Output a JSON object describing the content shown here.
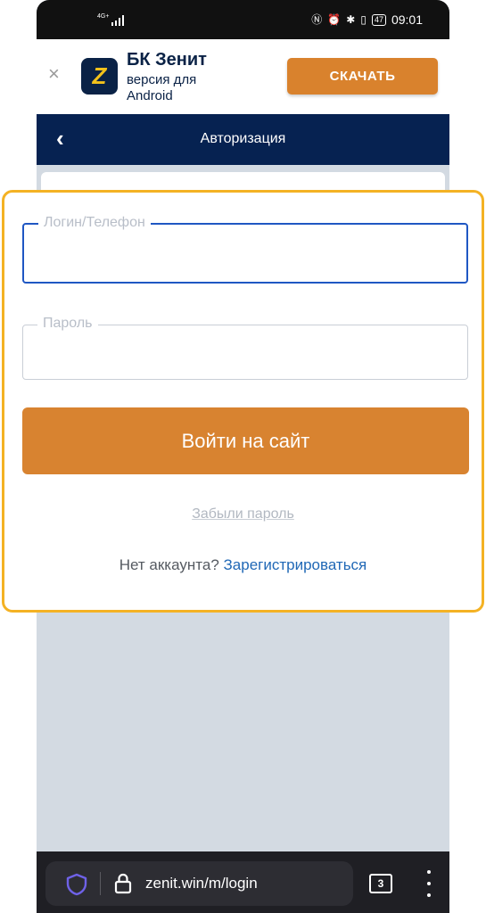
{
  "status_bar": {
    "network": "4G+",
    "battery": "47",
    "time": "09:01",
    "icons": [
      "nfc-icon",
      "alarm-icon",
      "bluetooth-icon",
      "vibrate-icon",
      "battery-icon"
    ]
  },
  "banner": {
    "close": "×",
    "logo_letter": "Z",
    "title": "БК Зенит",
    "subtitle": "версия для Android",
    "download_label": "СКАЧАТЬ"
  },
  "header": {
    "back": "‹",
    "title": "Авторизация"
  },
  "form": {
    "login_label": "Логин/Телефон",
    "login_value": "",
    "password_label": "Пароль",
    "password_value": "",
    "submit_label": "Войти на сайт",
    "forgot_label": "Забыли пароль",
    "no_account_text": "Нет аккаунта?",
    "register_label": "Зарегистрироваться"
  },
  "browser": {
    "url": "zenit.win/m/login",
    "tab_count": "3"
  },
  "colors": {
    "brand_navy": "#062251",
    "accent_orange": "#d88330",
    "highlight": "#f4b224",
    "link": "#2068b6"
  }
}
